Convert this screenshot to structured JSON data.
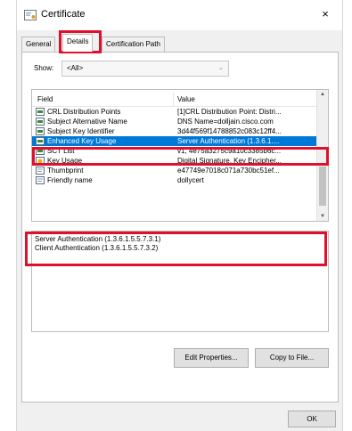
{
  "window": {
    "title": "Certificate",
    "close_glyph": "×"
  },
  "tabs": [
    {
      "label": "General",
      "active": false
    },
    {
      "label": "Details",
      "active": true
    },
    {
      "label": "Certification Path",
      "active": false
    }
  ],
  "show": {
    "label": "Show:",
    "value": "<All>",
    "arrow": "⌄"
  },
  "list": {
    "headers": {
      "field": "Field",
      "value": "Value"
    },
    "rows": [
      {
        "icon": "certificate-field-icon",
        "field": "CRL Distribution Points",
        "value": "[1]CRL Distribution Point: Distri..."
      },
      {
        "icon": "certificate-field-icon",
        "field": "Subject Alternative Name",
        "value": "DNS Name=dolljain.cisco.com"
      },
      {
        "icon": "certificate-field-icon",
        "field": "Subject Key Identifier",
        "value": "3d44f569f14788852c083c12ff4..."
      },
      {
        "icon": "certificate-field-icon",
        "field": "Enhanced Key Usage",
        "value": "Server Authentication (1.3.6.1....",
        "selected": true
      },
      {
        "icon": "certificate-field-icon",
        "field": "SCT List",
        "value": "v1, 4e75a3275c9a10c3385b6c..."
      },
      {
        "icon": "key-usage-icon",
        "field": "Key Usage",
        "value": "Digital Signature, Key Encipher..."
      },
      {
        "icon": "document-icon",
        "field": "Thumbprint",
        "value": "e47749e7018c071a730bc51ef..."
      },
      {
        "icon": "document-icon",
        "field": "Friendly name",
        "value": "dollycert"
      }
    ]
  },
  "detail": {
    "lines": [
      "Server Authentication (1.3.6.1.5.5.7.3.1)",
      "Client Authentication (1.3.6.1.5.5.7.3.2)"
    ]
  },
  "buttons": {
    "edit": "Edit Properties...",
    "copy": "Copy to File...",
    "ok": "OK"
  },
  "colors": {
    "selection": "#0078d7",
    "highlight": "#e0102c"
  }
}
